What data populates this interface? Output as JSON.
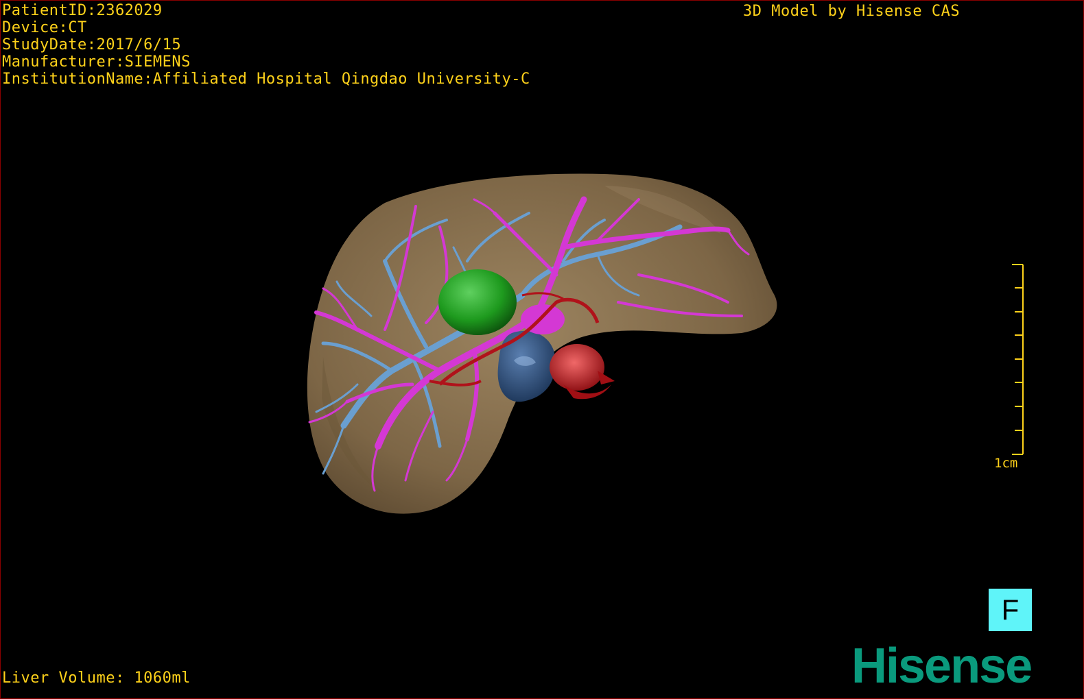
{
  "overlay": {
    "patient_id": "PatientID:2362029",
    "device": "Device:CT",
    "study_date": "StudyDate:2017/6/15",
    "manufacturer": "Manufacturer:SIEMENS",
    "institution": "InstitutionName:Affiliated Hospital Qingdao University-C",
    "credit": "3D Model by Hisense CAS",
    "liver_volume": "Liver Volume: 1060ml"
  },
  "scale_bar": {
    "label": "1cm",
    "tick_count": 9
  },
  "orientation_button": {
    "label": "F"
  },
  "brand": {
    "logo_text": "Hisense"
  },
  "colors": {
    "overlay_text": "#ffd21a",
    "liver": "#8a7150",
    "portal_vein": "#d438d4",
    "hepatic_vein": "#6a9fd0",
    "artery": "#b0121a",
    "gallbladder_green": "#1f9a1f",
    "dark_blue_vessel": "#2c4a78",
    "orientation_button_bg": "#5ff4f9",
    "brand": "#0a9a7d",
    "border": "#8b0000"
  },
  "model_parts": [
    "liver-surface",
    "portal-vein-tree",
    "hepatic-vein-tree",
    "green-structure",
    "dark-blue-structure",
    "arterial-structure"
  ]
}
